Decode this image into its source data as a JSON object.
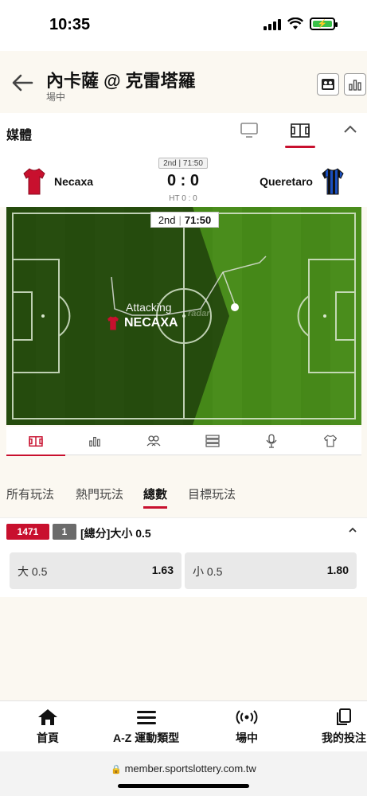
{
  "status": {
    "time": "10:35"
  },
  "header": {
    "title": "內卡薩 @ 克雷塔羅",
    "subtitle": "場中"
  },
  "media": {
    "label": "媒體"
  },
  "match": {
    "period_pill": "2nd | 71:50",
    "home_team": "Necaxa",
    "away_team": "Queretaro",
    "score": "0 : 0",
    "ht": "HT 0 : 0",
    "home_color": "#c8102e",
    "away_colors": [
      "#1a4fbf",
      "#111111"
    ]
  },
  "pitch": {
    "clock_period": "2nd",
    "clock_time": "71:50",
    "attack_label": "Attacking",
    "attack_team": "NECAXA",
    "watermark": "radar"
  },
  "play_tabs": [
    "所有玩法",
    "熱門玩法",
    "總數",
    "目標玩法"
  ],
  "active_play_tab": "總數",
  "market": {
    "id": "1471",
    "count": "1",
    "name": "[總分]大小 0.5",
    "options": [
      {
        "label": "大 0.5",
        "odds": "1.63"
      },
      {
        "label": "小 0.5",
        "odds": "1.80"
      }
    ]
  },
  "tabbar": {
    "home": "首頁",
    "az": "A-Z 運動類型",
    "live": "場中",
    "mybets": "我的投注"
  },
  "url": "member.sportslottery.com.tw",
  "colors": {
    "accent": "#c8102e",
    "pitch": "#4a8d1c"
  }
}
